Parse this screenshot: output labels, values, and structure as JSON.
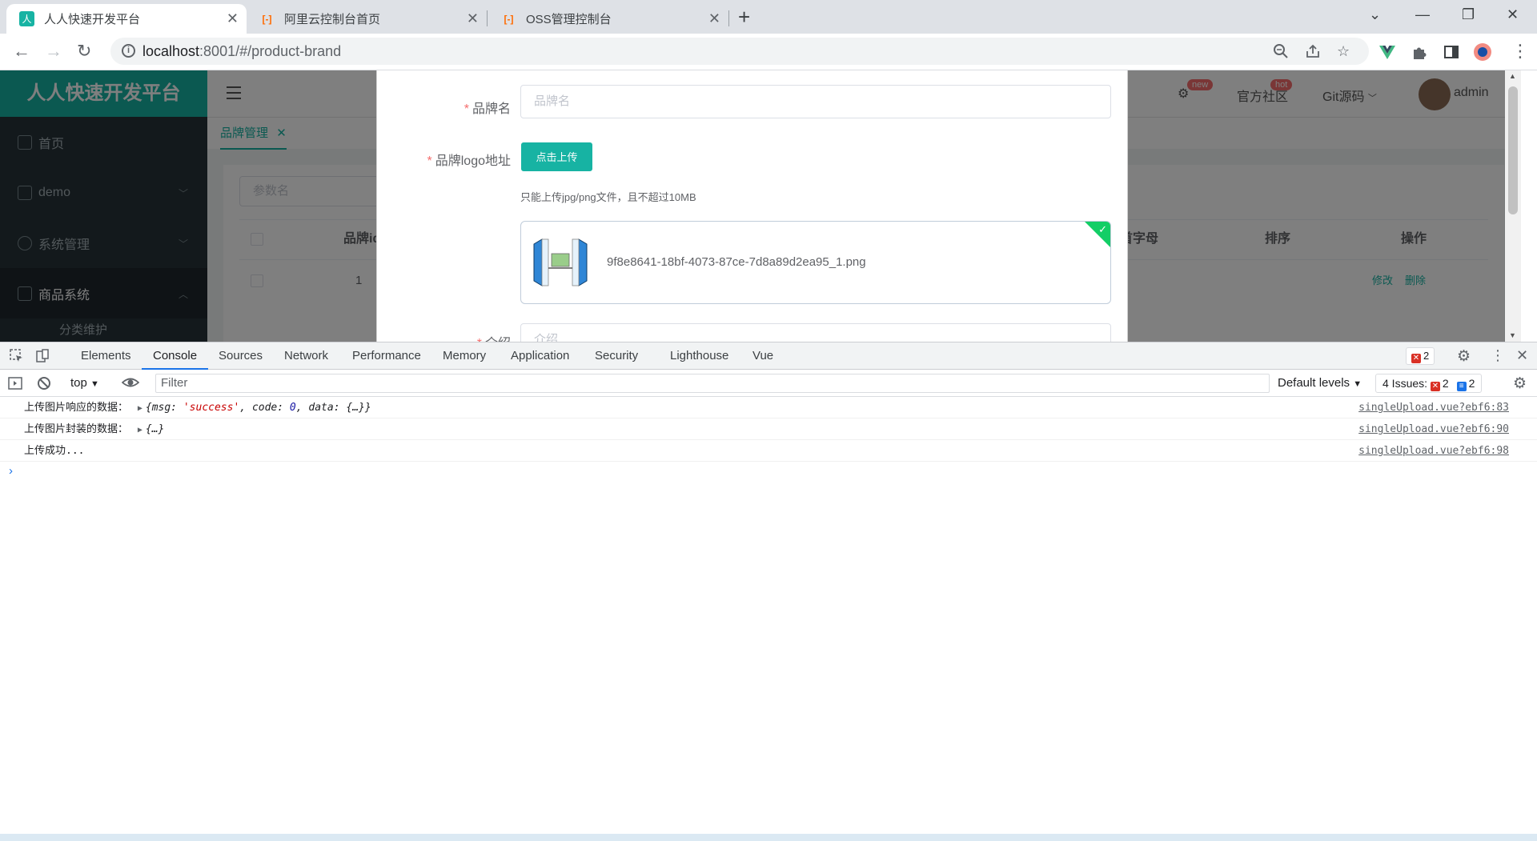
{
  "browser": {
    "tabs": [
      {
        "title": "人人快速开发平台",
        "favicon": "人"
      },
      {
        "title": "阿里云控制台首页",
        "favicon": "[-]"
      },
      {
        "title": "OSS管理控制台",
        "favicon": "[-]"
      }
    ],
    "url_host": "localhost",
    "url_path": ":8001/#/product-brand"
  },
  "app": {
    "brand": "人人快速开发平台",
    "menu": [
      {
        "label": "首页"
      },
      {
        "label": "demo"
      },
      {
        "label": "系统管理"
      },
      {
        "label": "商品系统"
      }
    ],
    "submenu_label": "分类维护",
    "topnav": {
      "community": "官方社区",
      "git": "Git源码",
      "badge_new": "new",
      "badge_hot": "hot",
      "user": "admin"
    },
    "current_tab": "品牌管理",
    "search_placeholder": "参数名",
    "table_headers": [
      "品牌id",
      "首字母",
      "排序",
      "操作"
    ],
    "row": {
      "id": "1",
      "edit": "修改",
      "delete": "删除"
    }
  },
  "dialog": {
    "name_label": "品牌名",
    "name_placeholder": "品牌名",
    "logo_label": "品牌logo地址",
    "upload_button": "点击上传",
    "upload_tip": "只能上传jpg/png文件，且不超过10MB",
    "file_name": "9f8e8641-18bf-4073-87ce-7d8a89d2ea95_1.png",
    "intro_label": "介绍",
    "intro_placeholder": "介绍"
  },
  "devtools": {
    "tabs": [
      "Elements",
      "Console",
      "Sources",
      "Network",
      "Performance",
      "Memory",
      "Application",
      "Security",
      "Lighthouse",
      "Vue"
    ],
    "error_count": "2",
    "context": "top",
    "filter_placeholder": "Filter",
    "levels": "Default levels",
    "issues_label": "4 Issues:",
    "issues_errors": "2",
    "issues_info": "2",
    "logs": [
      {
        "text": "上传图片响应的数据：",
        "source": "singleUpload.vue?ebf6:83"
      },
      {
        "text": "上传图片封装的数据：",
        "object": "{…}",
        "source": "singleUpload.vue?ebf6:90"
      },
      {
        "text": "上传成功...",
        "source": "singleUpload.vue?ebf6:98"
      }
    ],
    "log1_obj": {
      "open": "{msg: ",
      "msg_val": "'success'",
      "code_key": ", code: ",
      "code_val": "0",
      "rest": ", data: {…}}"
    }
  }
}
